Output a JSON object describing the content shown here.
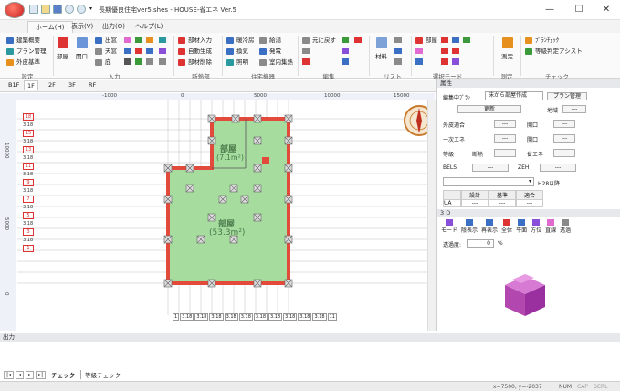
{
  "title": "長期優良住宅ver5.shes - HOUSE-省エネ Ver.5",
  "window": {
    "minimize": "—",
    "maximize": "☐",
    "close": "✕"
  },
  "menu_tabs": [
    "ホーム(H)",
    "表示(V)",
    "出力(O)",
    "ヘルプ(L)"
  ],
  "ribbon": {
    "settings": {
      "items": [
        "建築概要",
        "プラン管理",
        "外皮基準"
      ],
      "label": "設定"
    },
    "input": {
      "big": [
        "部屋",
        "開口"
      ],
      "items": [
        "出窓",
        "天窓",
        "庇"
      ],
      "label": "入力"
    },
    "insulation": {
      "items": [
        "部材入力",
        "自動生成",
        "部材削除"
      ],
      "label": "断熱部"
    },
    "equipment": {
      "items": [
        "暖冷房",
        "給湯",
        "換気",
        "発電",
        "照明",
        "室内集熱"
      ],
      "label": "住宅機器"
    },
    "edit": {
      "items": [
        "元に戻す"
      ],
      "label": "編集"
    },
    "list": {
      "items": [
        "材料"
      ],
      "label": "リスト"
    },
    "select_mode": {
      "items": [
        "部屋"
      ],
      "label": "選択モード"
    },
    "measure": {
      "items": [
        "測定"
      ],
      "label": "測定"
    },
    "check": {
      "items": [
        "ﾌﾟﾗﾝﾁｪｯｸ",
        "等級判定アシスト"
      ],
      "label": "チェック"
    }
  },
  "floor_tabs": [
    "B1F",
    "1F",
    "2F",
    "3F",
    "RF"
  ],
  "active_floor": "1F",
  "ruler_top": [
    "-1000",
    "0",
    "5000",
    "10000",
    "15000"
  ],
  "ruler_left": [
    "10000",
    "5000",
    "0"
  ],
  "row_labels": [
    "18",
    "3.18",
    "15",
    "3.18",
    "13",
    "3.18",
    "11",
    "3.18",
    "9",
    "3.18",
    "7",
    "3.18",
    "5",
    "3.18",
    "3",
    "3.18",
    "1"
  ],
  "col_labels": [
    "1",
    "3.18",
    "3.18",
    "3.18",
    "3.18",
    "3.18",
    "3.18",
    "3.18",
    "3.18",
    "3.18",
    "3.18",
    "11"
  ],
  "rooms": [
    {
      "name": "部屋",
      "area": "(7.1m²)"
    },
    {
      "name": "部屋",
      "area": "(53.3m²)"
    }
  ],
  "properties": {
    "header": "属性",
    "plan_label": "編集中ﾌﾟﾗﾝ",
    "plan_value": "床から部屋作成",
    "plan_manage": "プラン管理",
    "update_btn": "更新",
    "region_label": "地域",
    "region_value": "---",
    "rows": [
      {
        "a": "外皮適合",
        "b": "---",
        "c": "開口",
        "d": "---"
      },
      {
        "a": "一次エネ",
        "b": "---",
        "c": "開口",
        "d": "---"
      },
      {
        "a": "等級",
        "a2": "断熱",
        "b": "---",
        "c": "省エネ",
        "d": "---"
      }
    ],
    "bels": "BELS",
    "bels_val": "---",
    "zeh": "ZEH",
    "zeh_val": "---",
    "h28": "H28以降",
    "table_headers": [
      "",
      "設計",
      "基準",
      "適合"
    ],
    "table_row": [
      "UA",
      "---",
      "---",
      "---"
    ]
  },
  "view3d": {
    "header": "3 D",
    "tools": [
      "モード",
      "陰表示",
      "再表示",
      "全体",
      "平面",
      "方位",
      "直線",
      "透過"
    ],
    "transparency_label": "透過度:",
    "transparency_value": "0",
    "transparency_unit": "%"
  },
  "output": {
    "header": "出力",
    "tabs": [
      "チェック",
      "等級チェック"
    ]
  },
  "status": {
    "coords": "x=7500, y=-2037",
    "num": "NUM",
    "cap": "CAP",
    "scrl": "SCRL"
  }
}
